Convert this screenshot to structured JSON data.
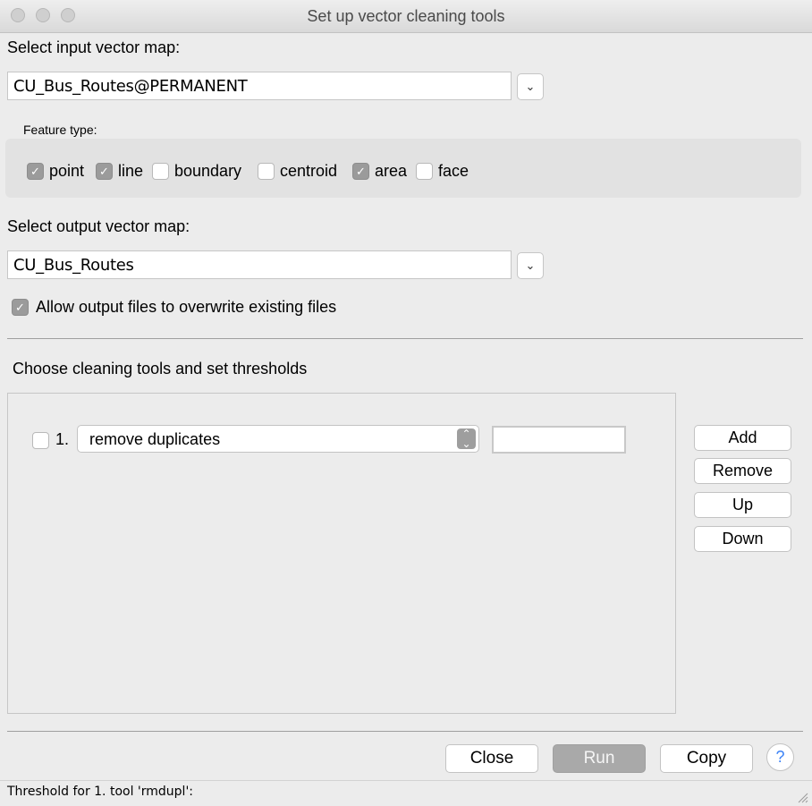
{
  "window": {
    "title": "Set up vector cleaning tools"
  },
  "input": {
    "label": "Select input vector map:",
    "value": "CU_Bus_Routes@PERMANENT"
  },
  "feature_type": {
    "label": "Feature type:",
    "options": [
      {
        "label": "point",
        "checked": true
      },
      {
        "label": "line",
        "checked": true
      },
      {
        "label": "boundary",
        "checked": false
      },
      {
        "label": "centroid",
        "checked": false
      },
      {
        "label": "area",
        "checked": true
      },
      {
        "label": "face",
        "checked": false
      }
    ]
  },
  "output": {
    "label": "Select output vector map:",
    "value": "CU_Bus_Routes",
    "overwrite_label": "Allow output files to overwrite existing files",
    "overwrite_checked": true
  },
  "tools": {
    "heading": "Choose cleaning tools and set thresholds",
    "rows": [
      {
        "index": "1.",
        "tool": "remove duplicates",
        "checked": false,
        "threshold": ""
      }
    ],
    "buttons": {
      "add": "Add",
      "remove": "Remove",
      "up": "Up",
      "down": "Down"
    }
  },
  "footer": {
    "close": "Close",
    "run": "Run",
    "copy": "Copy",
    "help": "?"
  },
  "status": {
    "text": "Threshold for 1. tool 'rmdupl':"
  },
  "colors": {
    "checked": "#9b9b9b",
    "help_blue": "#3b82f6",
    "disabled_button": "#a9a9a9"
  },
  "icons": {
    "dropdown": "chevron-down-icon",
    "select": "up-down-arrows-icon",
    "check": "checkmark-icon",
    "help": "question-mark-icon",
    "resize": "resize-grip-icon"
  }
}
